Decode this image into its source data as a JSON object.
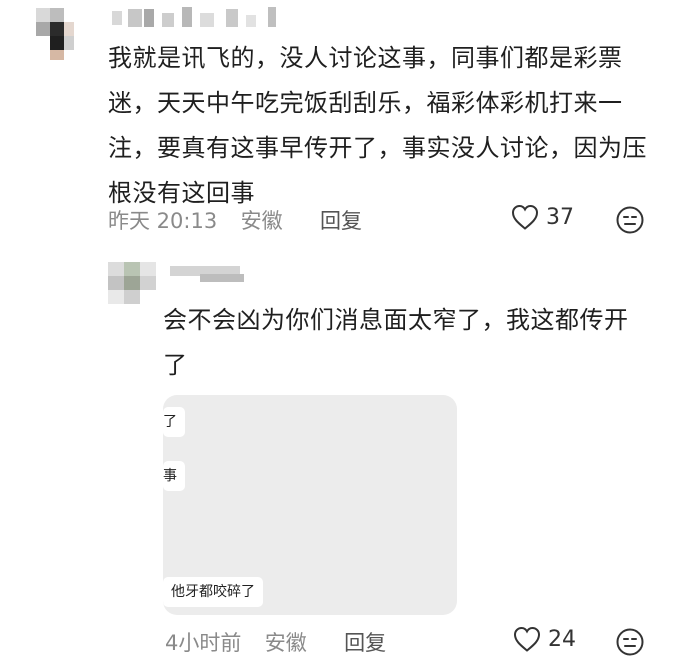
{
  "top_comment": {
    "author": "▘▜▝ ▖▌ ▗ ▘",
    "text": "我就是讯飞的，没人讨论这事，同事们都是彩票迷，天天中午吃完饭刮刮乐，福彩体彩机打来一注，要真有这事早传开了，事实没人讨论，因为压根没有这回事",
    "time": "昨天 20:13",
    "location": "安徽",
    "reply_label": "回复",
    "likes": "37"
  },
  "reply_comment": {
    "author": "▀▀▀▀",
    "text": "会不会凶为你们消息面太窄了，我这都传开了",
    "image_snippets": [
      "了",
      "事",
      "他牙都咬碎了"
    ],
    "time": "4小时前",
    "location": "安徽",
    "reply_label": "回复",
    "likes": "24"
  },
  "icons": {
    "heart": "heart-outline-icon",
    "emoji": "neutral-face-icon"
  }
}
